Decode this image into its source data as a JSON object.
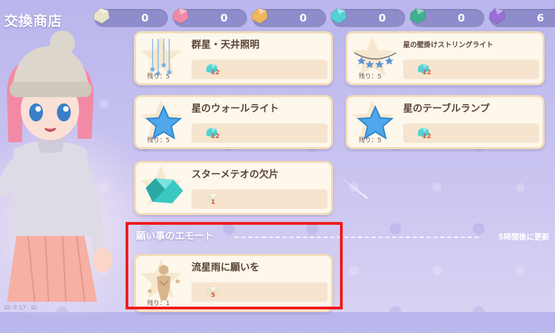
{
  "header": {
    "title": "交換商店",
    "currencies": [
      {
        "icon": "white-gem-icon",
        "color": "#e8e4c9",
        "count": "0"
      },
      {
        "icon": "pink-gem-icon",
        "color": "#f08aa8",
        "count": "0"
      },
      {
        "icon": "orange-gem-icon",
        "color": "#f0b65a",
        "count": "0"
      },
      {
        "icon": "cyan-gem-icon",
        "color": "#53d1d4",
        "count": "0"
      },
      {
        "icon": "green-gem-icon",
        "color": "#3fb08f",
        "count": "0"
      },
      {
        "icon": "purple-gem-icon",
        "color": "#9a6fd9",
        "count": "6"
      }
    ]
  },
  "items": [
    {
      "name": "群星・天井照明",
      "remaining": "残り：5",
      "price": "12",
      "icon": "hanging-stars-icon",
      "price_icon": "cyan-gem-icon"
    },
    {
      "name": "星の壁掛けストリングライト",
      "remaining": "残り：5",
      "price": "12",
      "icon": "string-lights-icon",
      "price_icon": "cyan-gem-icon"
    },
    {
      "name": "星のウォールライト",
      "remaining": "残り：5",
      "price": "12",
      "icon": "blue-star-icon",
      "price_icon": "cyan-gem-icon"
    },
    {
      "name": "星のテーブルランプ",
      "remaining": "残り：5",
      "price": "12",
      "icon": "blue-star-icon",
      "price_icon": "cyan-gem-icon"
    },
    {
      "name": "スターメテオの欠片",
      "remaining": "",
      "price": "1",
      "icon": "meteor-fragment-icon",
      "price_icon": "white-gem-icon"
    }
  ],
  "section": {
    "title": "願い事のエモート",
    "refresh": "5時間後に更新"
  },
  "emote_item": {
    "name": "流星雨に願いを",
    "remaining": "残り：1",
    "price": "5",
    "icon": "wishing-figure-icon",
    "price_icon": "white-gem-icon"
  },
  "watermark": "ID: P 17 · ID",
  "colors": {
    "card_bg": "#fdf7ec",
    "card_border": "#f2dcb9",
    "price_red": "#e0553d",
    "highlight": "#ee1c1c"
  }
}
